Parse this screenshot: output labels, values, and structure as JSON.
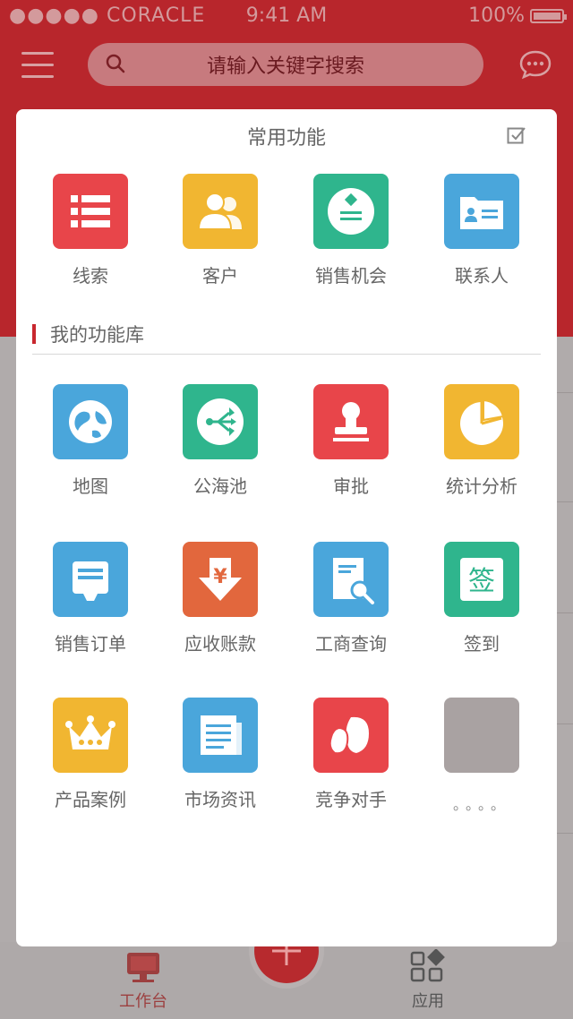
{
  "status_bar": {
    "carrier": "●●●●● CORACLE",
    "time": "9:41 AM",
    "battery": "100%"
  },
  "header": {
    "search_placeholder": "请输入关键字搜索"
  },
  "modal": {
    "title": "常用功能",
    "common": [
      {
        "label": "线索",
        "color": "#e8454a",
        "icon": "list-icon"
      },
      {
        "label": "客户",
        "color": "#f1b631",
        "icon": "people-icon"
      },
      {
        "label": "销售机会",
        "color": "#2fb58d",
        "icon": "opportunity-icon"
      },
      {
        "label": "联系人",
        "color": "#4aa6db",
        "icon": "contact-card-icon"
      }
    ],
    "library_title": "我的功能库",
    "library": [
      {
        "label": "地图",
        "color": "#4aa6db",
        "icon": "globe-icon"
      },
      {
        "label": "公海池",
        "color": "#2fb58d",
        "icon": "share-icon"
      },
      {
        "label": "审批",
        "color": "#e8454a",
        "icon": "stamp-icon"
      },
      {
        "label": "统计分析",
        "color": "#f1b631",
        "icon": "pie-chart-icon"
      },
      {
        "label": "销售订单",
        "color": "#4aa6db",
        "icon": "order-icon"
      },
      {
        "label": "应收账款",
        "color": "#e2673d",
        "icon": "yen-download-icon"
      },
      {
        "label": "工商查询",
        "color": "#4aa6db",
        "icon": "document-search-icon"
      },
      {
        "label": "签到",
        "color": "#2fb58d",
        "icon": "checkin-icon",
        "glyph": "签"
      },
      {
        "label": "产品案例",
        "color": "#f1b631",
        "icon": "crown-icon"
      },
      {
        "label": "市场资讯",
        "color": "#4aa6db",
        "icon": "newspaper-icon"
      },
      {
        "label": "竞争对手",
        "color": "#e8454a",
        "icon": "boxing-glove-icon"
      },
      {
        "label": "。。。。",
        "color": "#a9a2a2",
        "icon": "more-placeholder"
      }
    ]
  },
  "tabbar": {
    "workbench": "工作台",
    "apps": "应用"
  }
}
